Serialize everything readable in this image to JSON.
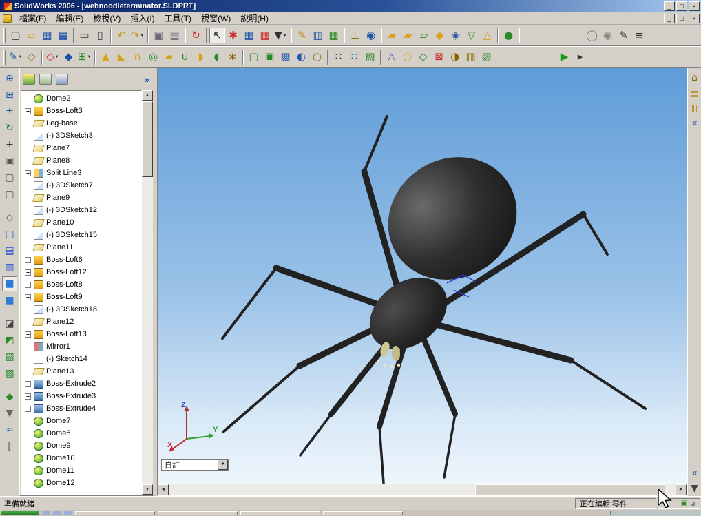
{
  "window": {
    "title": "SolidWorks 2006 - [webnoodleterminator.SLDPRT]",
    "controls": {
      "minimize": "_",
      "maximize": "□",
      "close": "×"
    }
  },
  "document_window": {
    "controls": {
      "minimize": "_",
      "restore": "□",
      "close": "×"
    }
  },
  "menu": {
    "items": [
      "檔案(F)",
      "編輯(E)",
      "檢視(V)",
      "插入(I)",
      "工具(T)",
      "視窗(W)",
      "說明(H)"
    ]
  },
  "toolbar_main": {
    "icons": [
      {
        "n": "new-document",
        "g": "▢",
        "c": "#444"
      },
      {
        "n": "open-document",
        "g": "▱",
        "c": "#d9a21b"
      },
      {
        "n": "save-document",
        "g": "▦",
        "c": "#2255aa"
      },
      {
        "n": "save-all",
        "g": "▩",
        "c": "#2255aa"
      },
      {
        "n": "print-document",
        "g": "▭",
        "c": "#444",
        "s": 1
      },
      {
        "n": "print-preview",
        "g": "▯",
        "c": "#444"
      },
      {
        "n": "undo",
        "g": "↶",
        "c": "#c79a1c",
        "s": 1
      },
      {
        "n": "redo",
        "g": "↷",
        "c": "#c79a1c",
        "d": 1
      },
      {
        "n": "copy",
        "g": "▣",
        "c": "#667",
        "s": 1
      },
      {
        "n": "paste",
        "g": "▤",
        "c": "#667"
      },
      {
        "n": "rebuild",
        "g": "↻",
        "c": "#cc3333",
        "s": 1
      },
      {
        "n": "select",
        "g": "↖",
        "c": "#111",
        "p": 1,
        "s": 1
      },
      {
        "n": "tool-13",
        "g": "✱",
        "c": "#cc3333"
      },
      {
        "n": "design-table",
        "g": "▦",
        "c": "#2255aa"
      },
      {
        "n": "tool-15",
        "g": "▦",
        "c": "#cc3333"
      },
      {
        "n": "tool-16",
        "g": "▼",
        "c": "#333",
        "d": 1
      },
      {
        "n": "tool-17",
        "g": "✎",
        "c": "#b8860b",
        "s": 1
      },
      {
        "n": "tool-18",
        "g": "▥",
        "c": "#2255aa"
      },
      {
        "n": "tool-19",
        "g": "▦",
        "c": "#2a8a2a"
      },
      {
        "n": "measure",
        "g": "⊥",
        "c": "#886600",
        "s": 1
      },
      {
        "n": "tool-21",
        "g": "◉",
        "c": "#2255aa"
      },
      {
        "n": "tool-22",
        "g": "▰",
        "c": "#d9a21b",
        "s": 1
      },
      {
        "n": "tool-23",
        "g": "▰",
        "c": "#d9a21b"
      },
      {
        "n": "tool-24",
        "g": "▱",
        "c": "#2a8a2a"
      },
      {
        "n": "tool-25",
        "g": "◆",
        "c": "#d9a21b"
      },
      {
        "n": "tool-26",
        "g": "◈",
        "c": "#2255aa"
      },
      {
        "n": "tool-27",
        "g": "▽",
        "c": "#2a8a2a"
      },
      {
        "n": "tool-28",
        "g": "△",
        "c": "#d9a21b"
      },
      {
        "n": "tool-29",
        "g": "●",
        "c": "#2a8a2a",
        "s": 1
      },
      {
        "n": "view-sphere",
        "g": "◯",
        "c": "#777",
        "gap": 1,
        "s": 1
      },
      {
        "n": "render-sphere",
        "g": "◉",
        "c": "#888"
      },
      {
        "n": "annotate-pencil",
        "g": "✎",
        "c": "#333"
      },
      {
        "n": "command-list",
        "g": "≡",
        "c": "#333"
      }
    ]
  },
  "toolbar_features": {
    "icons": [
      {
        "n": "sketch",
        "g": "✎",
        "c": "#2255aa",
        "d": 1
      },
      {
        "n": "smart-dimension",
        "g": "◇",
        "c": "#886600"
      },
      {
        "n": "feat-3",
        "g": "◇",
        "c": "#cc3333",
        "d": 1,
        "s": 1
      },
      {
        "n": "feat-4",
        "g": "◆",
        "c": "#2255aa"
      },
      {
        "n": "feat-5",
        "g": "⊞",
        "c": "#2a8a2a",
        "d": 1
      },
      {
        "n": "feat-6",
        "g": "▲",
        "c": "#d9a21b",
        "s": 1
      },
      {
        "n": "feat-7",
        "g": "◣",
        "c": "#d9a21b"
      },
      {
        "n": "feat-8",
        "g": "∩",
        "c": "#d9a21b"
      },
      {
        "n": "feat-9",
        "g": "◎",
        "c": "#2a8a2a"
      },
      {
        "n": "feat-10",
        "g": "▰",
        "c": "#d9a21b"
      },
      {
        "n": "feat-11",
        "g": "∪",
        "c": "#2a8a2a"
      },
      {
        "n": "feat-12",
        "g": "◗",
        "c": "#d9a21b"
      },
      {
        "n": "feat-13",
        "g": "◖",
        "c": "#2a8a2a"
      },
      {
        "n": "feat-14",
        "g": "∗",
        "c": "#886600"
      },
      {
        "n": "feat-15",
        "g": "▢",
        "c": "#2a8a2a",
        "s": 1
      },
      {
        "n": "feat-16",
        "g": "▣",
        "c": "#2a8a2a"
      },
      {
        "n": "feat-17",
        "g": "▩",
        "c": "#2255aa"
      },
      {
        "n": "feat-18",
        "g": "◐",
        "c": "#2255aa"
      },
      {
        "n": "feat-19",
        "g": "○",
        "c": "#886600"
      },
      {
        "n": "feat-20",
        "g": "∷",
        "c": "#333",
        "s": 1
      },
      {
        "n": "feat-21",
        "g": "∷",
        "c": "#2255aa"
      },
      {
        "n": "feat-22",
        "g": "▨",
        "c": "#2a8a2a"
      },
      {
        "n": "feat-23",
        "g": "△",
        "c": "#2255aa",
        "s": 1
      },
      {
        "n": "feat-24",
        "g": "○",
        "c": "#d9a21b"
      },
      {
        "n": "feat-25",
        "g": "◇",
        "c": "#2a8a2a"
      },
      {
        "n": "feat-26",
        "g": "⊠",
        "c": "#cc3333"
      },
      {
        "n": "feat-27",
        "g": "◑",
        "c": "#886600"
      },
      {
        "n": "feat-28",
        "g": "▥",
        "c": "#886600"
      },
      {
        "n": "feat-29",
        "g": "▧",
        "c": "#2a8a2a"
      },
      {
        "n": "run",
        "g": "▶",
        "c": "#1a9a1a",
        "gap": 1
      },
      {
        "n": "scroll-right",
        "g": "▸",
        "c": "#333"
      }
    ]
  },
  "toolbar_view_left": {
    "icons": [
      {
        "n": "zoom-to-fit",
        "g": "⊕",
        "c": "#1a55aa"
      },
      {
        "n": "zoom-area",
        "g": "⊞",
        "c": "#1a55aa"
      },
      {
        "n": "zoom-in-out",
        "g": "±",
        "c": "#1a55aa"
      },
      {
        "n": "rotate-view",
        "g": "↻",
        "c": "#0a7a3a"
      },
      {
        "n": "pan",
        "g": "+",
        "c": "#333"
      },
      {
        "n": "standard-views",
        "g": "▣",
        "c": "#555"
      },
      {
        "n": "front-view",
        "g": "▢",
        "c": "#555"
      },
      {
        "n": "right-view",
        "g": "▢",
        "c": "#555"
      },
      {
        "n": "isometric-view",
        "g": "◇",
        "c": "#555",
        "gap": 1
      },
      {
        "n": "wireframe",
        "g": "▢",
        "c": "#2255cc"
      },
      {
        "n": "hidden-lines-visible",
        "g": "▤",
        "c": "#2255cc"
      },
      {
        "n": "hidden-lines-removed",
        "g": "▥",
        "c": "#2255cc"
      },
      {
        "n": "shaded-with-edges",
        "g": "■",
        "c": "#2e7bd6",
        "p": 1
      },
      {
        "n": "shaded",
        "g": "■",
        "c": "#2e7bd6"
      },
      {
        "n": "shadows",
        "g": "◪",
        "c": "#444",
        "gap": 1
      },
      {
        "n": "section-view",
        "g": "◩",
        "c": "#2a8a2a"
      },
      {
        "n": "curvature",
        "g": "▨",
        "c": "#2a8a2a"
      },
      {
        "n": "zebra-stripes",
        "g": "▧",
        "c": "#2a8a2a"
      },
      {
        "n": "view-tool-1",
        "g": "◆",
        "c": "#2a8a2a",
        "gap": 1
      },
      {
        "n": "view-tool-2",
        "g": "▼",
        "c": "#666"
      },
      {
        "n": "view-tool-3",
        "g": "≈",
        "c": "#2255cc"
      },
      {
        "n": "view-tool-4",
        "g": "⌊",
        "c": "#666"
      }
    ]
  },
  "task_pane_right": {
    "icons_top": [
      {
        "n": "task-pane-home",
        "g": "⌂",
        "c": "#8a6a1a"
      },
      {
        "n": "design-library",
        "g": "▤",
        "c": "#b8860b"
      },
      {
        "n": "file-explorer",
        "g": "▥",
        "c": "#b8860b"
      },
      {
        "n": "collapse-task-pane",
        "g": "«",
        "c": "#1a55aa"
      }
    ],
    "icons_bottom": [
      {
        "n": "collapse-panel",
        "g": "«",
        "c": "#1a55aa"
      },
      {
        "n": "scroll-down",
        "g": "▼",
        "c": "#444"
      }
    ]
  },
  "feature_tree": {
    "collapse_chevron": "»",
    "items": [
      {
        "label": "Dome2",
        "icon": "dome"
      },
      {
        "label": "Boss-Loft3",
        "icon": "loft",
        "expand": true
      },
      {
        "label": "Leg-base",
        "icon": "plane"
      },
      {
        "label": "(-) 3DSketch3",
        "icon": "sketch3d"
      },
      {
        "label": "Plane7",
        "icon": "plane"
      },
      {
        "label": "Plane8",
        "icon": "plane"
      },
      {
        "label": "Split Line3",
        "icon": "splitline",
        "expand": true
      },
      {
        "label": "(-) 3DSketch7",
        "icon": "sketch3d"
      },
      {
        "label": "Plane9",
        "icon": "plane"
      },
      {
        "label": "(-) 3DSketch12",
        "icon": "sketch3d"
      },
      {
        "label": "Plane10",
        "icon": "plane"
      },
      {
        "label": "(-) 3DSketch15",
        "icon": "sketch3d"
      },
      {
        "label": "Plane11",
        "icon": "plane"
      },
      {
        "label": "Boss-Loft6",
        "icon": "loft",
        "expand": true
      },
      {
        "label": "Boss-Loft12",
        "icon": "loft",
        "expand": true
      },
      {
        "label": "Boss-Loft8",
        "icon": "loft",
        "expand": true
      },
      {
        "label": "Boss-Loft9",
        "icon": "loft",
        "expand": true
      },
      {
        "label": "(-) 3DSketch18",
        "icon": "sketch3d"
      },
      {
        "label": "Plane12",
        "icon": "plane"
      },
      {
        "label": "Boss-Loft13",
        "icon": "loft",
        "expand": true
      },
      {
        "label": "Mirror1",
        "icon": "mirror"
      },
      {
        "label": "(-) Sketch14",
        "icon": "sketch"
      },
      {
        "label": "Plane13",
        "icon": "plane"
      },
      {
        "label": "Boss-Extrude2",
        "icon": "extrude",
        "expand": true
      },
      {
        "label": "Boss-Extrude3",
        "icon": "extrude",
        "expand": true
      },
      {
        "label": "Boss-Extrude4",
        "icon": "extrude",
        "expand": true
      },
      {
        "label": "Dome7",
        "icon": "dome"
      },
      {
        "label": "Dome8",
        "icon": "dome"
      },
      {
        "label": "Dome9",
        "icon": "dome"
      },
      {
        "label": "Dome10",
        "icon": "dome"
      },
      {
        "label": "Dome11",
        "icon": "dome"
      },
      {
        "label": "Dome12",
        "icon": "dome"
      }
    ]
  },
  "viewport": {
    "orientation_combo": {
      "value": "自訂"
    },
    "triad": {
      "x": "X",
      "y": "Y",
      "z": "Z"
    }
  },
  "statusbar": {
    "ready": "準備就緒",
    "editing": "正在編輯:零件"
  },
  "colors": {
    "titlebar_start": "#0a246a",
    "titlebar_end": "#a6caf0",
    "chrome": "#d4d0c8",
    "viewport_top": "#5f9cd8",
    "viewport_bottom": "#eef6fc"
  }
}
